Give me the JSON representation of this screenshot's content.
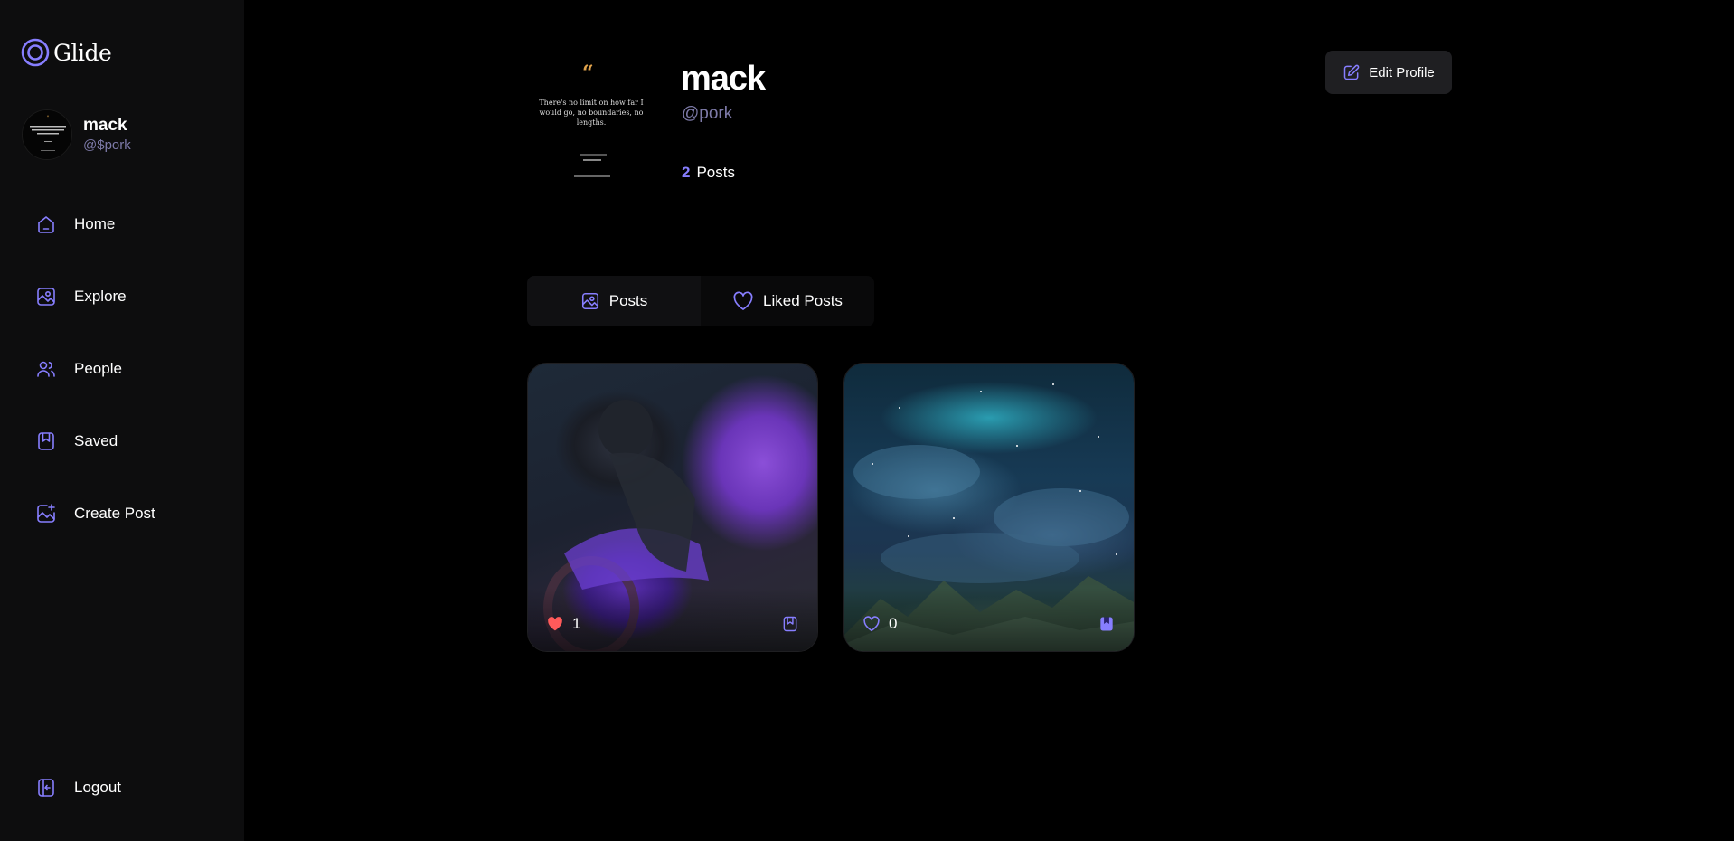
{
  "app": {
    "name": "Glide"
  },
  "user": {
    "name": "mack",
    "handle": "@$pork"
  },
  "nav": {
    "items": [
      {
        "label": "Home",
        "icon": "home-icon"
      },
      {
        "label": "Explore",
        "icon": "explore-icon"
      },
      {
        "label": "People",
        "icon": "people-icon"
      },
      {
        "label": "Saved",
        "icon": "saved-icon"
      },
      {
        "label": "Create Post",
        "icon": "create-post-icon"
      }
    ],
    "logout": "Logout"
  },
  "profile": {
    "name": "mack",
    "handle": "@pork",
    "posts_count": "2",
    "posts_label": "Posts",
    "edit_label": "Edit Profile",
    "avatar_quote": "There's no limit on how far I would go, no boundaries, no lengths."
  },
  "tabs": [
    {
      "label": "Posts",
      "icon": "image-icon"
    },
    {
      "label": "Liked Posts",
      "icon": "heart-icon"
    }
  ],
  "posts": [
    {
      "likes": "1",
      "liked": true,
      "saved": false
    },
    {
      "likes": "0",
      "liked": false,
      "saved": true
    }
  ],
  "colors": {
    "accent": "#877eff",
    "like": "#ff5a5a",
    "sidebar_bg": "#0d0d0e",
    "muted": "#7d7aa8"
  }
}
